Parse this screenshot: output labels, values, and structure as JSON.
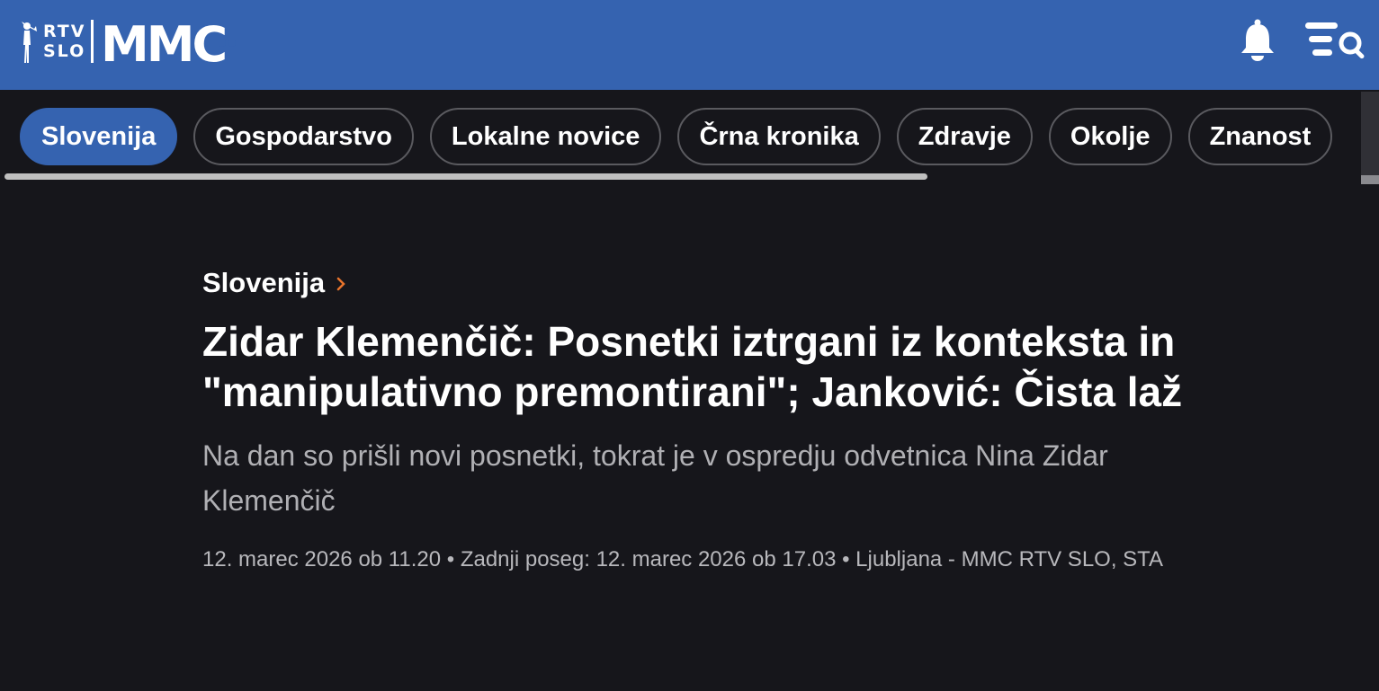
{
  "header": {
    "logo_rtv_top": "RTV",
    "logo_rtv_bottom": "SLO",
    "logo_mmc": "MMC",
    "icons": [
      "bell-icon",
      "search-menu-icon"
    ],
    "brand_color": "#3563b0"
  },
  "categories": [
    {
      "label": "Slovenija",
      "active": true
    },
    {
      "label": "Gospodarstvo",
      "active": false
    },
    {
      "label": "Lokalne novice",
      "active": false
    },
    {
      "label": "Črna kronika",
      "active": false
    },
    {
      "label": "Zdravje",
      "active": false
    },
    {
      "label": "Okolje",
      "active": false
    },
    {
      "label": "Znanost",
      "active": false
    }
  ],
  "article": {
    "breadcrumb": "Slovenija",
    "headline": "Zidar Klemenčič: Posnetki iztrgani iz konteksta in \"manipulativno premontirani\"; Janković: Čista laž",
    "lead": "Na dan so prišli novi posnetki, tokrat je v ospredju odvetnica Nina Zidar Klemenčič",
    "meta": "12. marec 2026 ob 11.20 • Zadnji poseg: 12. marec 2026 ob 17.03 • Ljubljana - MMC RTV SLO, STA"
  },
  "colors": {
    "background": "#16161b",
    "accent_chevron": "#e8742c"
  }
}
